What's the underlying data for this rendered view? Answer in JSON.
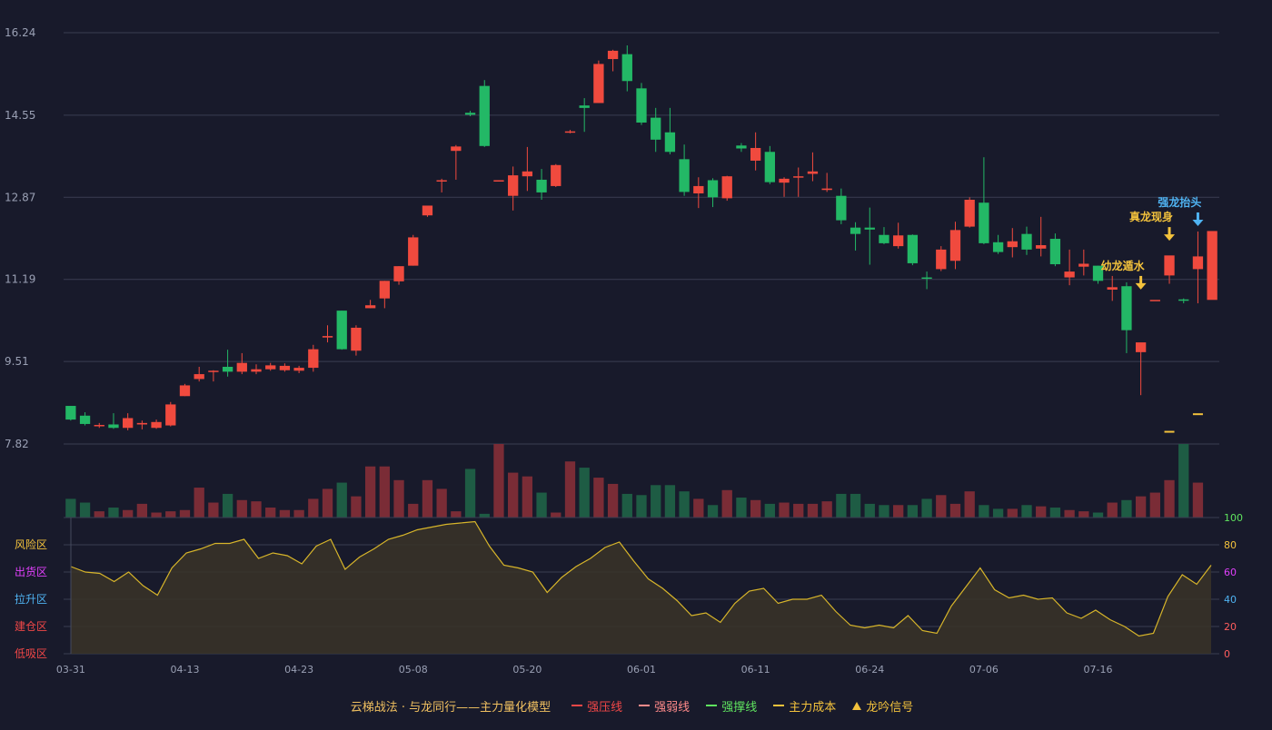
{
  "legend": {
    "title": "云梯战法 · 与龙同行——主力量化模型",
    "items": [
      {
        "label": "强压线",
        "color": "#f04747",
        "style": "solid"
      },
      {
        "label": "强弱线",
        "color": "#ff8a8a",
        "style": "dash"
      },
      {
        "label": "强撑线",
        "color": "#5fe35f",
        "style": "solid"
      },
      {
        "label": "主力成本",
        "color": "#f3c23c",
        "style": "dash"
      },
      {
        "label": "龙吟信号",
        "color": "#f3c23c",
        "style": "triangle"
      }
    ]
  },
  "colors": {
    "up": "#f04a3e",
    "down": "#23b866",
    "vol_up": "#7a2c36",
    "vol_down": "#1e5c44",
    "osc_line": "#d7b52a",
    "grid": "#3a3d52",
    "axis_text": "#9aa0b4",
    "signal": "#f3c23c",
    "signal_blue": "#4fb3f2"
  },
  "chart_data": [
    {
      "type": "candlestick",
      "y_axis": {
        "ticks": [
          "16.24",
          "14.55",
          "12.87",
          "11.19",
          "9.51",
          "7.82"
        ],
        "ylim": [
          7.82,
          16.24
        ]
      },
      "x_axis": {
        "ticks": [
          {
            "label": "03-31",
            "index": 0
          },
          {
            "label": "04-13",
            "index": 8
          },
          {
            "label": "04-23",
            "index": 16
          },
          {
            "label": "05-08",
            "index": 24
          },
          {
            "label": "05-20",
            "index": 32
          },
          {
            "label": "06-01",
            "index": 40
          },
          {
            "label": "06-11",
            "index": 48
          },
          {
            "label": "06-24",
            "index": 56
          },
          {
            "label": "07-06",
            "index": 64
          },
          {
            "label": "07-16",
            "index": 72
          }
        ]
      },
      "ohlc": [
        [
          8.6,
          8.6,
          8.3,
          8.32
        ],
        [
          8.4,
          8.47,
          8.2,
          8.23
        ],
        [
          8.2,
          8.25,
          8.15,
          8.21
        ],
        [
          8.22,
          8.45,
          8.13,
          8.15
        ],
        [
          8.15,
          8.45,
          8.1,
          8.35
        ],
        [
          8.22,
          8.3,
          8.12,
          8.25
        ],
        [
          8.15,
          8.32,
          8.13,
          8.27
        ],
        [
          8.2,
          8.68,
          8.18,
          8.63
        ],
        [
          8.8,
          9.05,
          8.8,
          9.02
        ],
        [
          9.15,
          9.4,
          9.1,
          9.25
        ],
        [
          9.3,
          9.33,
          9.1,
          9.32
        ],
        [
          9.4,
          9.75,
          9.2,
          9.3
        ],
        [
          9.3,
          9.68,
          9.25,
          9.48
        ],
        [
          9.3,
          9.45,
          9.25,
          9.35
        ],
        [
          9.35,
          9.48,
          9.32,
          9.43
        ],
        [
          9.33,
          9.47,
          9.3,
          9.42
        ],
        [
          9.32,
          9.42,
          9.27,
          9.38
        ],
        [
          9.38,
          9.85,
          9.3,
          9.76
        ],
        [
          10.0,
          10.25,
          9.9,
          10.03
        ],
        [
          10.55,
          10.55,
          9.75,
          9.76
        ],
        [
          9.73,
          10.25,
          9.63,
          10.2
        ],
        [
          10.6,
          10.77,
          10.6,
          10.66
        ],
        [
          10.8,
          11.16,
          10.6,
          11.16
        ],
        [
          11.15,
          11.46,
          11.08,
          11.46
        ],
        [
          11.47,
          12.1,
          11.47,
          12.05
        ],
        [
          12.5,
          12.55,
          12.47,
          12.7
        ],
        [
          13.2,
          13.25,
          12.97,
          13.22
        ],
        [
          13.82,
          13.94,
          13.23,
          13.91
        ],
        [
          14.6,
          14.64,
          14.53,
          14.56
        ],
        [
          15.15,
          15.27,
          13.9,
          13.92
        ],
        [
          13.22,
          13.22,
          13.2,
          13.22
        ],
        [
          12.9,
          13.5,
          12.6,
          13.32
        ],
        [
          13.3,
          13.9,
          13.0,
          13.4
        ],
        [
          13.23,
          13.45,
          12.82,
          12.97
        ],
        [
          13.1,
          13.55,
          13.08,
          13.53
        ],
        [
          14.21,
          14.25,
          14.18,
          14.22
        ],
        [
          14.75,
          14.9,
          14.21,
          14.7
        ],
        [
          14.8,
          15.67,
          14.8,
          15.6
        ],
        [
          15.7,
          15.89,
          15.45,
          15.87
        ],
        [
          15.8,
          15.98,
          15.04,
          15.25
        ],
        [
          15.1,
          15.21,
          14.35,
          14.4
        ],
        [
          14.5,
          14.7,
          13.8,
          14.05
        ],
        [
          14.2,
          14.7,
          13.75,
          13.8
        ],
        [
          13.65,
          13.95,
          12.9,
          12.98
        ],
        [
          12.95,
          13.28,
          12.65,
          13.1
        ],
        [
          13.22,
          13.26,
          12.67,
          12.87
        ],
        [
          12.85,
          13.31,
          12.8,
          13.3
        ],
        [
          13.93,
          13.98,
          13.8,
          13.87
        ],
        [
          13.62,
          14.2,
          13.42,
          13.88
        ],
        [
          13.8,
          13.92,
          13.14,
          13.18
        ],
        [
          13.17,
          13.28,
          12.88,
          13.25
        ],
        [
          13.3,
          13.48,
          12.88,
          13.3
        ],
        [
          13.35,
          13.79,
          13.2,
          13.4
        ],
        [
          13.02,
          13.37,
          12.98,
          13.05
        ],
        [
          12.9,
          13.05,
          12.32,
          12.4
        ],
        [
          12.25,
          12.36,
          11.78,
          12.12
        ],
        [
          12.25,
          12.66,
          11.49,
          12.21
        ],
        [
          12.1,
          12.26,
          11.91,
          11.93
        ],
        [
          11.87,
          12.35,
          11.82,
          12.09
        ],
        [
          12.1,
          12.11,
          11.48,
          11.52
        ],
        [
          11.23,
          11.35,
          10.99,
          11.21
        ],
        [
          11.4,
          11.87,
          11.36,
          11.8
        ],
        [
          11.57,
          12.37,
          11.4,
          12.2
        ],
        [
          12.27,
          12.87,
          12.25,
          12.82
        ],
        [
          12.76,
          13.69,
          11.91,
          11.93
        ],
        [
          11.95,
          12.1,
          11.71,
          11.75
        ],
        [
          11.85,
          12.24,
          11.64,
          11.97
        ],
        [
          12.12,
          12.27,
          11.69,
          11.8
        ],
        [
          11.82,
          12.47,
          11.66,
          11.89
        ],
        [
          12.02,
          12.13,
          11.46,
          11.5
        ],
        [
          11.23,
          11.8,
          11.07,
          11.35
        ],
        [
          11.45,
          11.8,
          11.27,
          11.51
        ],
        [
          11.47,
          11.47,
          11.1,
          11.16
        ],
        [
          10.98,
          11.26,
          10.75,
          11.03
        ],
        [
          11.05,
          11.13,
          9.68,
          10.15
        ],
        [
          9.7,
          9.81,
          8.82,
          9.9
        ],
        [
          10.77,
          10.77,
          10.77,
          10.77
        ],
        [
          11.27,
          11.28,
          11.1,
          11.68
        ],
        [
          10.78,
          10.8,
          10.7,
          10.77
        ],
        [
          11.4,
          12.17,
          10.7,
          11.66
        ],
        [
          10.77,
          10.77,
          10.77,
          12.18
        ]
      ],
      "annotations": [
        {
          "text": "幼龙遁水",
          "index": 75,
          "price": 11.0,
          "color": "#f3c23c"
        },
        {
          "text": "真龙现身",
          "index": 77,
          "price": 12.0,
          "color": "#f3c23c"
        },
        {
          "text": "强龙抬头",
          "index": 79,
          "price": 12.3,
          "color": "#4fb3f2"
        }
      ],
      "cost_ticks": [
        {
          "index": 77,
          "price": 8.07
        },
        {
          "index": 79,
          "price": 8.43
        }
      ]
    },
    {
      "type": "bar",
      "name": "volume",
      "values": [
        30,
        24,
        10,
        16,
        12,
        22,
        8,
        10,
        12,
        48,
        24,
        38,
        28,
        26,
        16,
        12,
        12,
        30,
        46,
        56,
        34,
        82,
        82,
        60,
        22,
        60,
        46,
        10,
        78,
        6,
        118,
        72,
        66,
        40,
        8,
        90,
        80,
        64,
        54,
        38,
        36,
        52,
        52,
        42,
        30,
        20,
        44,
        32,
        28,
        22,
        24,
        22,
        22,
        26,
        38,
        38,
        22,
        20,
        20,
        20,
        30,
        36,
        22,
        42,
        20,
        14,
        14,
        20,
        18,
        16,
        12,
        10,
        8,
        24,
        28,
        34,
        40,
        60,
        118,
        56
      ]
    },
    {
      "type": "area",
      "name": "oscillator",
      "y_axis": {
        "ticks": [
          "0",
          "20",
          "40",
          "60",
          "80",
          "100"
        ],
        "ylim": [
          0,
          100
        ]
      },
      "zone_labels": [
        {
          "label": "风险区",
          "color": "#f3c23c"
        },
        {
          "label": "出货区",
          "color": "#e040fb"
        },
        {
          "label": "拉升区",
          "color": "#4fb3f2"
        },
        {
          "label": "建仓区",
          "color": "#f04747"
        },
        {
          "label": "低吸区",
          "color": "#f04747"
        }
      ],
      "values": [
        64,
        60,
        59,
        53,
        60,
        50,
        43,
        63,
        74,
        77,
        81,
        81,
        84,
        70,
        74,
        72,
        66,
        79,
        84,
        62,
        71,
        77,
        84,
        87,
        91,
        93,
        95,
        96,
        97,
        79,
        65,
        63,
        60,
        45,
        56,
        64,
        70,
        78,
        82,
        68,
        55,
        48,
        39,
        28,
        30,
        23,
        37,
        46,
        48,
        37,
        40,
        40,
        43,
        31,
        21,
        19,
        21,
        19,
        28,
        17,
        15,
        35,
        49,
        63,
        47,
        41,
        43,
        40,
        41,
        30,
        26,
        32,
        25,
        20,
        13,
        15,
        42,
        58,
        51,
        65
      ]
    }
  ]
}
